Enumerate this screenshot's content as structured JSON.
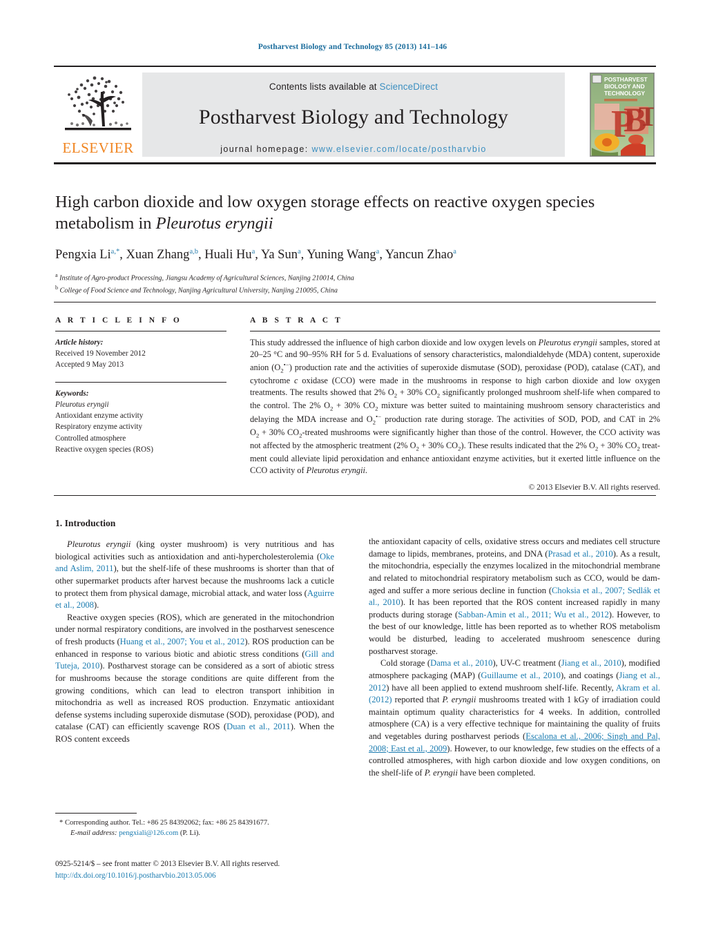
{
  "running_head": "Postharvest Biology and Technology 85 (2013) 141–146",
  "masthead": {
    "contents_prefix": "Contents lists available at ",
    "sciencedirect": "ScienceDirect",
    "journal_title": "Postharvest Biology and Technology",
    "homepage_prefix": "journal homepage: ",
    "homepage_url": "www.elsevier.com/locate/postharvbio",
    "publisher": "ELSEVIER",
    "cover_title_line1": "POSTHARVEST",
    "cover_title_line2": "BIOLOGY AND",
    "cover_title_line3": "TECHNOLOGY",
    "cover_letters": "PBT"
  },
  "title": {
    "line1": "High carbon dioxide and low oxygen storage effects on reactive oxygen species",
    "line2_prefix": "metabolism in ",
    "line2_italic": "Pleurotus eryngii"
  },
  "authors": [
    {
      "name": "Pengxia Li",
      "marks": "a,*"
    },
    {
      "name": "Xuan Zhang",
      "marks": "a,b"
    },
    {
      "name": "Huali Hu",
      "marks": "a"
    },
    {
      "name": "Ya Sun",
      "marks": "a"
    },
    {
      "name": "Yuning Wang",
      "marks": "a"
    },
    {
      "name": "Yancun Zhao",
      "marks": "a"
    }
  ],
  "affiliations": [
    {
      "mark": "a",
      "text": "Institute of Agro-product Processing, Jiangsu Academy of Agricultural Sciences, Nanjing 210014, China"
    },
    {
      "mark": "b",
      "text": "College of Food Science and Technology, Nanjing Agricultural University, Nanjing 210095, China"
    }
  ],
  "article_info": {
    "heading": "A R T I C L E    I N F O",
    "history_label": "Article history:",
    "history": [
      "Received 19 November 2012",
      "Accepted 9 May 2013"
    ],
    "keywords_label": "Keywords:",
    "keywords": [
      "Pleurotus eryngii",
      "Antioxidant enzyme activity",
      "Respiratory enzyme activity",
      "Controlled atmosphere",
      "Reactive oxygen species (ROS)"
    ]
  },
  "abstract": {
    "heading": "A B S T R A C T",
    "copyright": "© 2013 Elsevier B.V. All rights reserved."
  },
  "sections": {
    "introduction_heading": "1.  Introduction"
  },
  "footnote": {
    "star_line": "* Corresponding author. Tel.: +86 25 84392062; fax: +86 25 84391677.",
    "email_label": "E-mail address:",
    "email": "pengxiali@126.com",
    "email_suffix": "(P. Li)."
  },
  "footer": {
    "issn_line": "0925-5214/$ – see front matter © 2013 Elsevier B.V. All rights reserved.",
    "doi": "http://dx.doi.org/10.1016/j.postharvbio.2013.05.006"
  },
  "colors": {
    "link": "#1a7bb0",
    "header_blue": "#1a6c9c",
    "sciencedirect": "#3c8fc0",
    "elsevier_orange": "#f08521",
    "band_gray": "#e6e7e8"
  }
}
